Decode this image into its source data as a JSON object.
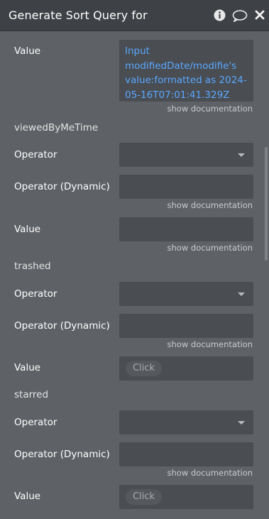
{
  "header": {
    "title": "Generate Sort Query for",
    "info_icon": "info-icon",
    "comment_icon": "comment-icon",
    "close_icon": "close-icon"
  },
  "value_field": {
    "label": "Value",
    "dynamic_text": " Input modifiedDate/modifie's value:formatted as 2024-05-16T07:01:41.329Z"
  },
  "doc_link": "show documentation",
  "sections": [
    {
      "name": "viewedByMeTime",
      "operator_label": "Operator",
      "operator_dynamic_label": "Operator (Dynamic)",
      "value_label": "Value",
      "value_placeholder": ""
    },
    {
      "name": "trashed",
      "operator_label": "Operator",
      "operator_dynamic_label": "Operator (Dynamic)",
      "value_label": "Value",
      "value_placeholder": "Click"
    },
    {
      "name": "starred",
      "operator_label": "Operator",
      "operator_dynamic_label": "Operator (Dynamic)",
      "value_label": "Value",
      "value_placeholder": "Click"
    }
  ]
}
